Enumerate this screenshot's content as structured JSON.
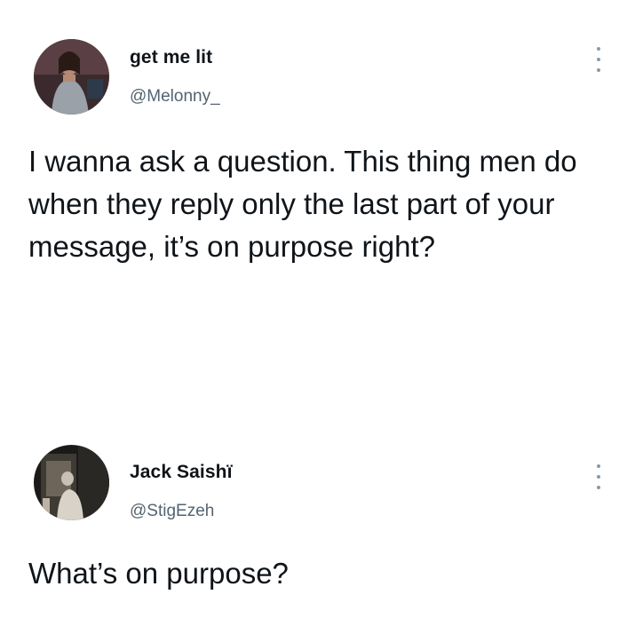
{
  "tweets": [
    {
      "display_name": "get me lit",
      "handle": "@Melonny_",
      "text": "I wanna ask a question. This thing men do when they reply only the last part of your message, it’s on purpose right?",
      "menu_icon": "more-vertical-icon"
    },
    {
      "display_name": "Jack Saishï",
      "handle": "@StigEzeh",
      "text": "What’s on purpose?",
      "menu_icon": "more-vertical-icon"
    }
  ],
  "colors": {
    "background": "#ffffff",
    "text_primary": "#0f1419",
    "text_secondary": "#536471",
    "icon": "#8b98a5"
  }
}
